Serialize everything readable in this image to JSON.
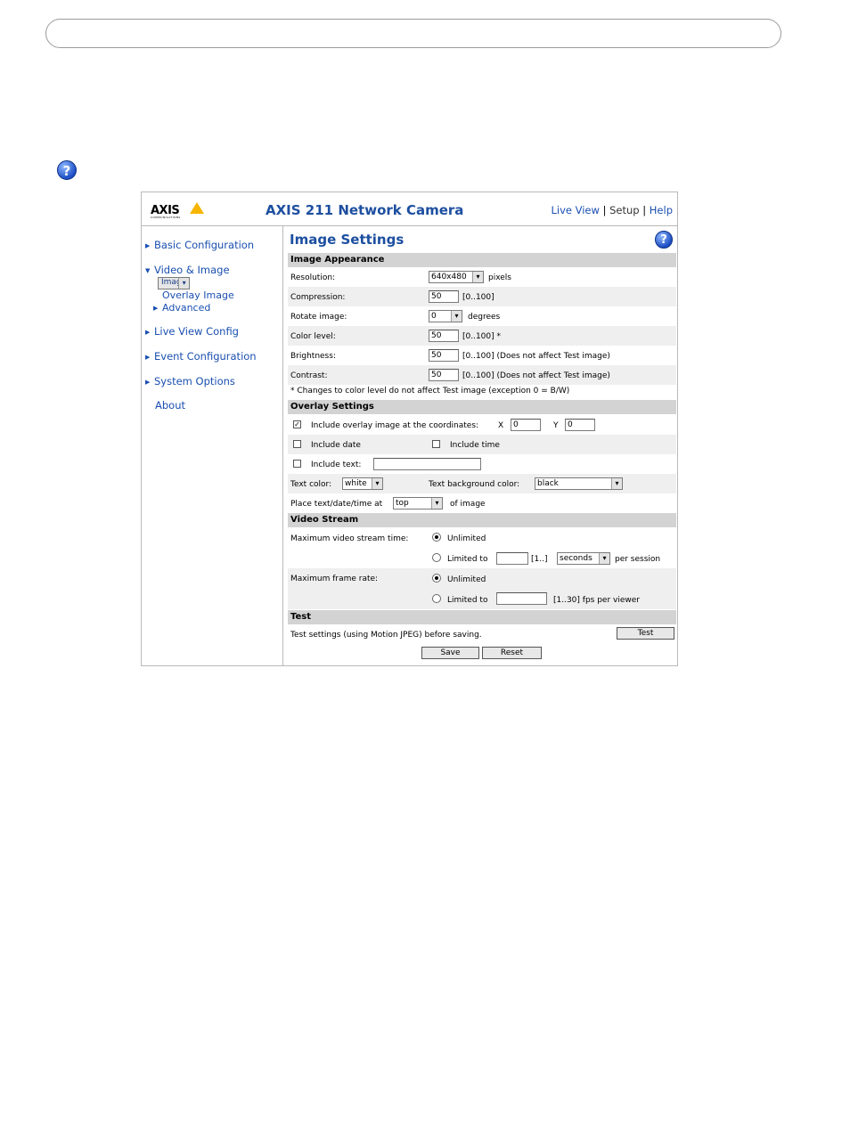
{
  "header": {
    "logo_text": "AXIS",
    "logo_sub": "COMMUNICATIONS",
    "product": "AXIS 211 Network Camera",
    "links": {
      "live_view": "Live View",
      "setup": "Setup",
      "help": "Help",
      "sep": "|"
    }
  },
  "nav": {
    "basic": "Basic Configuration",
    "video_image": "Video & Image",
    "image": "Image",
    "overlay_image": "Overlay Image",
    "advanced": "Advanced",
    "live_view_config": "Live View Config",
    "event_configuration": "Event Configuration",
    "system_options": "System Options",
    "about": "About"
  },
  "main": {
    "title": "Image Settings",
    "help_icon": "?",
    "appearance": {
      "header": "Image Appearance",
      "resolution_label": "Resolution:",
      "resolution_value": "640x480",
      "resolution_unit": "pixels",
      "compression_label": "Compression:",
      "compression_value": "50",
      "compression_range": "[0..100]",
      "rotate_label": "Rotate image:",
      "rotate_value": "0",
      "rotate_unit": "degrees",
      "color_label": "Color level:",
      "color_value": "50",
      "color_range": "[0..100] *",
      "brightness_label": "Brightness:",
      "brightness_value": "50",
      "brightness_range": "[0..100] (Does not affect Test image)",
      "contrast_label": "Contrast:",
      "contrast_value": "50",
      "contrast_range": "[0..100] (Does not affect Test image)",
      "note": "* Changes to color level do not affect Test image (exception 0 = B/W)"
    },
    "overlay": {
      "header": "Overlay Settings",
      "include_overlay": "Include overlay image at the coordinates:",
      "x_label": "X",
      "x_value": "0",
      "y_label": "Y",
      "y_value": "0",
      "include_date": "Include date",
      "include_time": "Include time",
      "include_text": "Include text:",
      "text_value": "",
      "text_color_label": "Text color:",
      "text_color_value": "white",
      "bg_color_label": "Text background color:",
      "bg_color_value": "black",
      "place_label": "Place text/date/time at",
      "place_value": "top",
      "place_suffix": "of image"
    },
    "stream": {
      "header": "Video Stream",
      "max_time_label": "Maximum video stream time:",
      "unlimited": "Unlimited",
      "limited_to": "Limited to",
      "time_value": "",
      "time_range": "[1..]",
      "time_unit": "seconds",
      "per_session": "per session",
      "max_rate_label": "Maximum frame rate:",
      "rate_value": "",
      "rate_range": "[1..30] fps per viewer"
    },
    "test": {
      "header": "Test",
      "text": "Test settings (using Motion JPEG) before saving.",
      "test_button": "Test",
      "save_button": "Save",
      "reset_button": "Reset"
    }
  },
  "colors": {
    "accent": "#1d4fa0",
    "link": "#1a4fb0",
    "section_bg": "#d3d3d3",
    "row_shade": "#efefef"
  }
}
